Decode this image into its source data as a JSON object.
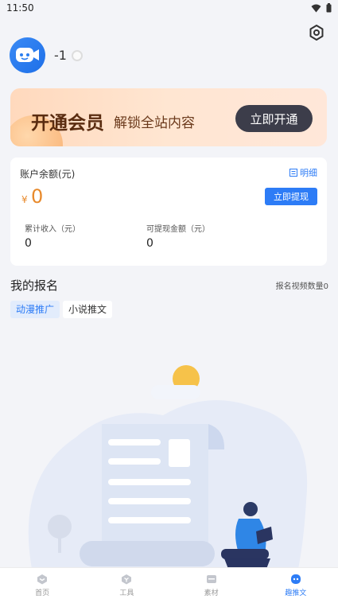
{
  "status": {
    "time": "11:50"
  },
  "profile": {
    "name": "-1"
  },
  "vip": {
    "title": "开通会员",
    "subtitle": "解锁全站内容",
    "button": "立即开通"
  },
  "account": {
    "label": "账户余额(元)",
    "detail": "明细",
    "currency": "¥",
    "balance": "0",
    "withdraw": "立即提现",
    "stats": [
      {
        "label": "累计收入（元）",
        "value": "0"
      },
      {
        "label": "可提现金额（元）",
        "value": "0"
      }
    ]
  },
  "signup": {
    "title": "我的报名",
    "count": "报名视频数量0",
    "tabs": [
      {
        "label": "动漫推广",
        "active": true
      },
      {
        "label": "小说推文",
        "active": false
      }
    ]
  },
  "nav": [
    {
      "label": "首页",
      "icon": "home-icon",
      "active": false
    },
    {
      "label": "工具",
      "icon": "tools-icon",
      "active": false
    },
    {
      "label": "素材",
      "icon": "material-icon",
      "active": false
    },
    {
      "label": "趣推文",
      "icon": "qutuiwen-icon",
      "active": true
    }
  ],
  "colors": {
    "accent": "#2d7cf6",
    "balance": "#e88a2c",
    "vip_button": "#3c3d4a"
  }
}
